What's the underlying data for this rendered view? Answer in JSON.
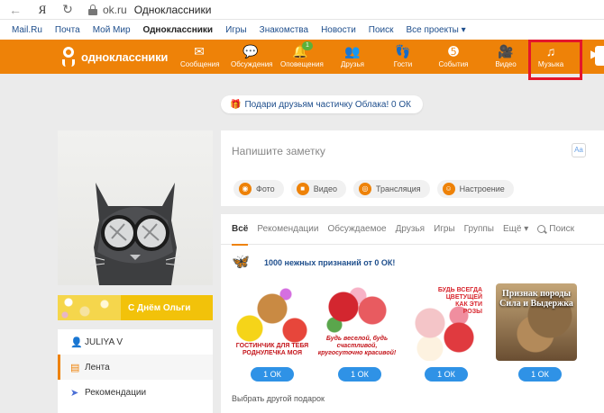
{
  "browser": {
    "url": "ok.ru",
    "page_title": "Одноклассники",
    "icons": [
      "back-arrow-icon",
      "yandex-icon",
      "reload-icon",
      "lock-icon"
    ]
  },
  "mailru_bar": {
    "links": [
      "Mail.Ru",
      "Почта",
      "Мой Мир",
      "Одноклассники",
      "Игры",
      "Знакомства",
      "Новости",
      "Поиск",
      "Все проекты ▾"
    ],
    "active_index": 3
  },
  "toolbar": {
    "brand": "одноклассники",
    "brand_color": "#ee8208",
    "items": [
      {
        "label": "Сообщения",
        "icon": "envelope-icon"
      },
      {
        "label": "Обсуждения",
        "icon": "chat-bubbles-icon"
      },
      {
        "label": "Оповещения",
        "icon": "bell-icon",
        "badge": "1"
      },
      {
        "label": "Друзья",
        "icon": "friends-icon"
      },
      {
        "label": "Гости",
        "icon": "footprints-icon"
      },
      {
        "label": "События",
        "icon": "events-icon"
      },
      {
        "label": "Видео",
        "icon": "video-camera-icon"
      },
      {
        "label": "Музыка",
        "icon": "music-note-icon"
      }
    ],
    "highlight_color": "#e4162b"
  },
  "gift_cloud": {
    "text": "Подари друзьям частичку Облака! 0 ОК"
  },
  "profile": {
    "banner_text": "С Днём Ольги",
    "menu": [
      {
        "label": "JULIYA V",
        "icon": "user-icon"
      },
      {
        "label": "Лента",
        "icon": "feed-icon",
        "active": true
      },
      {
        "label": "Рекомендации",
        "icon": "compass-icon"
      }
    ]
  },
  "note": {
    "placeholder": "Напишите заметку",
    "actions": [
      {
        "label": "Фото",
        "icon": "camera-icon"
      },
      {
        "label": "Видео",
        "icon": "video-icon"
      },
      {
        "label": "Трансляция",
        "icon": "broadcast-icon"
      },
      {
        "label": "Настроение",
        "icon": "smile-icon"
      }
    ]
  },
  "feed": {
    "tabs": [
      "Всё",
      "Рекомендации",
      "Обсуждаемое",
      "Друзья",
      "Игры",
      "Группы"
    ],
    "more": "Ещё ▾",
    "search": "Поиск",
    "promo_text": "1000 нежных признаний от 0 ОК!",
    "gifts": [
      {
        "caption": "ГОСТИНЧИК ДЛЯ ТЕБЯ РОДНУЛЕЧКА МОЯ",
        "price": "1 ОК"
      },
      {
        "caption": "Будь веселой, будь счастливой, кругосуточно красивой!",
        "price": "1 ОК"
      },
      {
        "caption": "БУДЬ ВСЕГДА ЦВЕТУЩЕЙ КАК ЭТИ РОЗЫ",
        "price": "1 ОК"
      },
      {
        "caption": "Признак породы Сила и Выдержка",
        "price": "1 ОК"
      }
    ],
    "choose_another": "Выбрать другой подарок"
  }
}
